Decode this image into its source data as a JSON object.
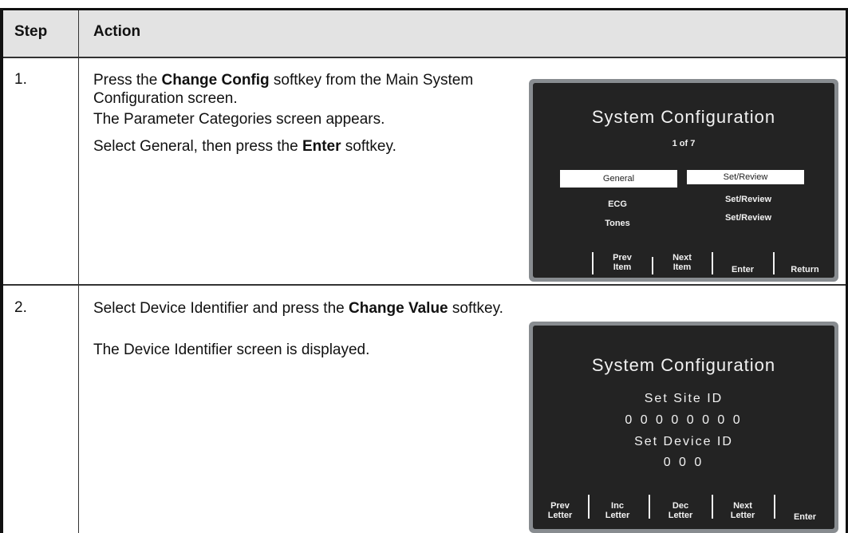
{
  "table": {
    "header_step": "Step",
    "header_action": "Action"
  },
  "rows": [
    {
      "step": "1.",
      "lines": [
        {
          "a": "Press the ",
          "b": "Change Config",
          "c": " softkey from the Main System Configuration screen."
        },
        {
          "a": "The Parameter Categories screen appears.",
          "b": "",
          "c": ""
        },
        {
          "a": "Select General, then press the ",
          "b": "Enter",
          "c": " softkey."
        }
      ],
      "screen": {
        "title": "System Configuration",
        "page": "1 of 7",
        "items": [
          {
            "label": "General",
            "value": "Set/Review"
          },
          {
            "label": "ECG",
            "value": "Set/Review"
          },
          {
            "label": "Tones",
            "value": "Set/Review"
          }
        ],
        "softkeys": [
          {
            "line1": "Prev",
            "line2": "Item"
          },
          {
            "line1": "Next",
            "line2": "Item"
          },
          {
            "line1": "Enter",
            "line2": ""
          },
          {
            "line1": "Return",
            "line2": ""
          }
        ]
      }
    },
    {
      "step": "2.",
      "lines": [
        {
          "a": "Select Device Identifier and press the ",
          "b": "Change Value",
          "c": " softkey."
        },
        {
          "a": "The Device Identifier screen is displayed.",
          "b": "",
          "c": ""
        }
      ],
      "screen": {
        "title": "System Configuration",
        "site_label": "Set Site ID",
        "site_value": "0 0 0 0 0 0 0 0",
        "device_label": "Set Device ID",
        "device_value": "0 0 0",
        "softkeys": [
          {
            "line1": "Prev",
            "line2": "Letter"
          },
          {
            "line1": "Inc",
            "line2": "Letter"
          },
          {
            "line1": "Dec",
            "line2": "Letter"
          },
          {
            "line1": "Next",
            "line2": "Letter"
          },
          {
            "line1": "Enter",
            "line2": ""
          }
        ]
      }
    }
  ]
}
